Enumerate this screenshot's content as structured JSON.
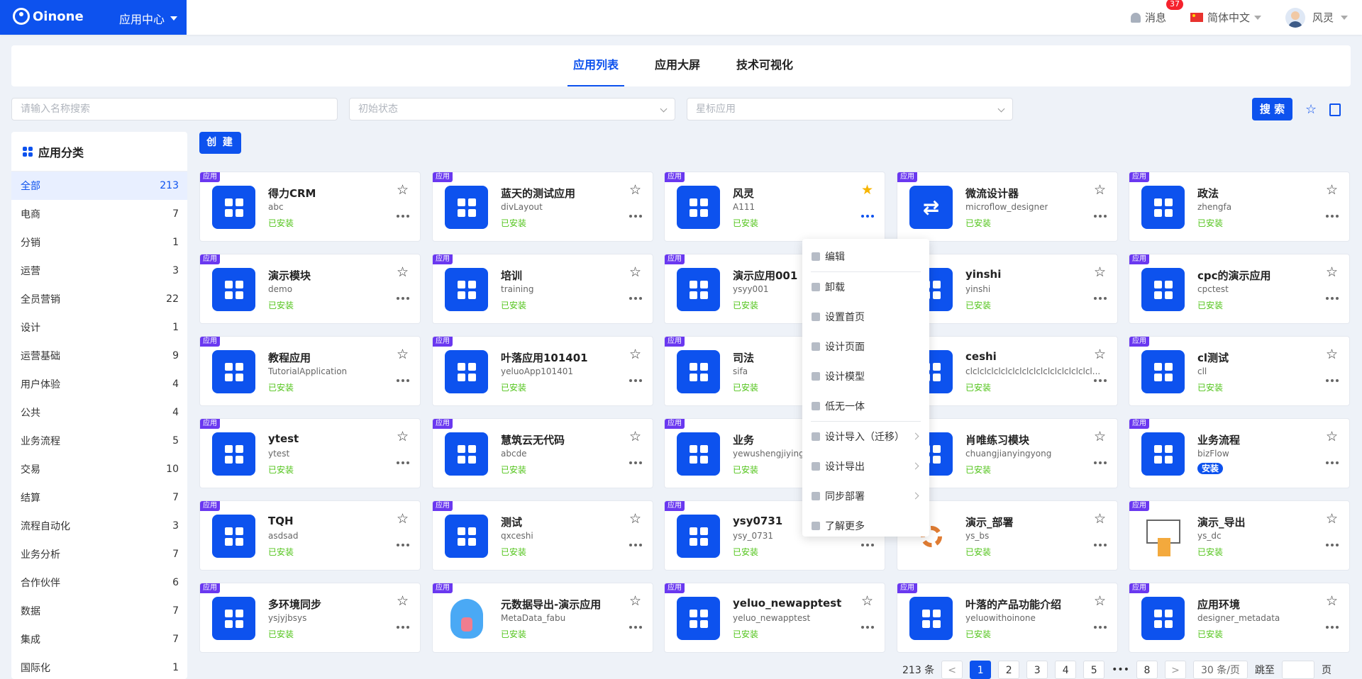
{
  "topbar": {
    "brand": "Oinone",
    "app_center": "应用中心",
    "messages_label": "消息",
    "messages_count": "37",
    "language": "简体中文",
    "user": "风灵"
  },
  "tabs": [
    "应用列表",
    "应用大屏",
    "技术可视化"
  ],
  "filters": {
    "search_placeholder": "请输入名称搜索",
    "status_placeholder": "初始状态",
    "star_placeholder": "星标应用",
    "search_button": "搜 索"
  },
  "create_button": "创 建",
  "sidebar": {
    "title": "应用分类",
    "items": [
      {
        "label": "全部",
        "count": "213"
      },
      {
        "label": "电商",
        "count": "7"
      },
      {
        "label": "分销",
        "count": "1"
      },
      {
        "label": "运营",
        "count": "3"
      },
      {
        "label": "全员营销",
        "count": "22"
      },
      {
        "label": "设计",
        "count": "1"
      },
      {
        "label": "运营基础",
        "count": "9"
      },
      {
        "label": "用户体验",
        "count": "4"
      },
      {
        "label": "公共",
        "count": "4"
      },
      {
        "label": "业务流程",
        "count": "5"
      },
      {
        "label": "交易",
        "count": "10"
      },
      {
        "label": "结算",
        "count": "7"
      },
      {
        "label": "流程自动化",
        "count": "3"
      },
      {
        "label": "业务分析",
        "count": "7"
      },
      {
        "label": "合作伙伴",
        "count": "6"
      },
      {
        "label": "数据",
        "count": "7"
      },
      {
        "label": "集成",
        "count": "7"
      },
      {
        "label": "国际化",
        "count": "1"
      }
    ]
  },
  "tag_label": "应用",
  "cards": [
    {
      "name": "得力CRM",
      "code": "abc",
      "status": "已安装"
    },
    {
      "name": "蓝天的测试应用",
      "code": "divLayout",
      "status": "已安装"
    },
    {
      "name": "风灵",
      "code": "A111",
      "status": "已安装"
    },
    {
      "name": "微流设计器",
      "code": "microflow_designer",
      "status": "已安装"
    },
    {
      "name": "政法",
      "code": "zhengfa",
      "status": "已安装"
    },
    {
      "name": "演示模块",
      "code": "demo",
      "status": "已安装"
    },
    {
      "name": "培训",
      "code": "training",
      "status": "已安装"
    },
    {
      "name": "演示应用001",
      "code": "ysyy001",
      "status": "已安装"
    },
    {
      "name": "yinshi",
      "code": "yinshi",
      "status": "已安装"
    },
    {
      "name": "cpc的演示应用",
      "code": "cpctest",
      "status": "已安装"
    },
    {
      "name": "教程应用",
      "code": "TutorialApplication",
      "status": "已安装"
    },
    {
      "name": "叶落应用101401",
      "code": "yeluoApp101401",
      "status": "已安装"
    },
    {
      "name": "司法",
      "code": "sifa",
      "status": "已安装"
    },
    {
      "name": "ceshi",
      "code": "clclclclclclclclclclclclclclclclclcl...",
      "status": "已安装"
    },
    {
      "name": "cl测试",
      "code": "cll",
      "status": "已安装"
    },
    {
      "name": "ytest",
      "code": "ytest",
      "status": "已安装"
    },
    {
      "name": "慧筑云无代码",
      "code": "abcde",
      "status": "已安装"
    },
    {
      "name": "业务",
      "code": "yewushengjiyingy",
      "status": "已安装"
    },
    {
      "name": "肖唯练习模块",
      "code": "chuangjianyingyong",
      "status": "已安装"
    },
    {
      "name": "业务流程",
      "code": "bizFlow",
      "status": "安装"
    },
    {
      "name": "TQH",
      "code": "asdsad",
      "status": "已安装"
    },
    {
      "name": "测试",
      "code": "qxceshi",
      "status": "已安装"
    },
    {
      "name": "ysy0731",
      "code": "ysy_0731",
      "status": "已安装"
    },
    {
      "name": "演示_部署",
      "code": "ys_bs",
      "status": "已安装"
    },
    {
      "name": "演示_导出",
      "code": "ys_dc",
      "status": "已安装"
    },
    {
      "name": "多环境同步",
      "code": "ysjyjbsys",
      "status": "已安装"
    },
    {
      "name": "元数据导出-演示应用",
      "code": "MetaData_fabu",
      "status": "已安装"
    },
    {
      "name": "yeluo_newapptest",
      "code": "yeluo_newapptest",
      "status": "已安装"
    },
    {
      "name": "叶落的产品功能介绍",
      "code": "yeluowithoinone",
      "status": "已安装"
    },
    {
      "name": "应用环境",
      "code": "designer_metadata",
      "status": "已安装"
    }
  ],
  "context_menu": [
    "编辑",
    "卸载",
    "设置首页",
    "设计页面",
    "设计模型",
    "低无一体",
    "设计导入（迁移）",
    "设计导出",
    "同步部署",
    "了解更多"
  ],
  "pagination": {
    "total": "213 条",
    "pages": [
      "1",
      "2",
      "3",
      "4",
      "5",
      "8"
    ],
    "ellipsis": "•••",
    "page_size": "30 条/页",
    "jump_label": "跳至",
    "page_suffix": "页"
  }
}
